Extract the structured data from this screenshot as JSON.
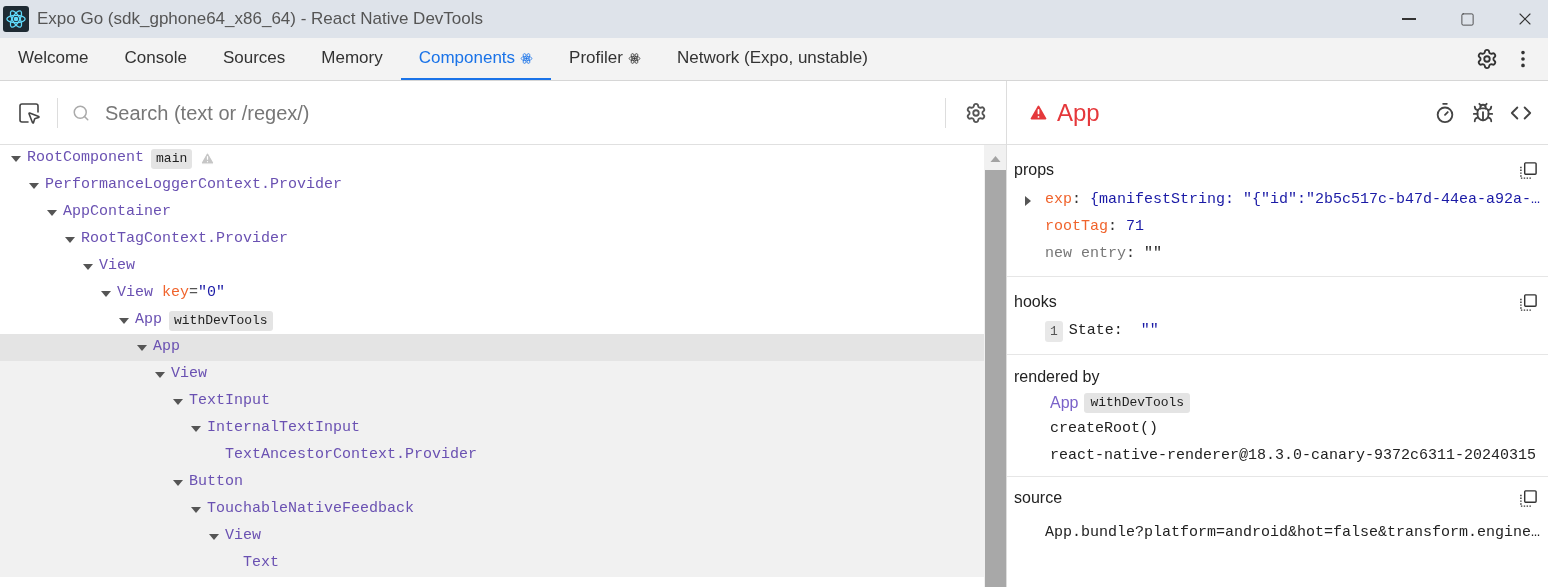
{
  "window": {
    "title": "Expo Go (sdk_gphone64_x86_64) - React Native DevTools"
  },
  "tabs": [
    {
      "label": "Welcome",
      "selected": false
    },
    {
      "label": "Console",
      "selected": false
    },
    {
      "label": "Sources",
      "selected": false
    },
    {
      "label": "Memory",
      "selected": false
    },
    {
      "label": "Components",
      "selected": true,
      "react_icon": true
    },
    {
      "label": "Profiler",
      "selected": false,
      "react_icon": true
    },
    {
      "label": "Network (Expo, unstable)",
      "selected": false
    }
  ],
  "search": {
    "placeholder": "Search (text or /regex/)"
  },
  "tree": [
    {
      "name": "RootComponent",
      "badge": "main",
      "warning": true,
      "expanded": true,
      "selected": false,
      "children": [
        {
          "name": "PerformanceLoggerContext.Provider",
          "expanded": true,
          "selected": false,
          "children": [
            {
              "name": "AppContainer",
              "expanded": true,
              "selected": false,
              "children": [
                {
                  "name": "RootTagContext.Provider",
                  "expanded": true,
                  "selected": false,
                  "children": [
                    {
                      "name": "View",
                      "expanded": true,
                      "selected": false,
                      "children": [
                        {
                          "name": "View",
                          "key_name": "key",
                          "key_sep": "=",
                          "key_value": "\"0\"",
                          "expanded": true,
                          "selected": false,
                          "children": [
                            {
                              "name": "App",
                              "badge": "withDevTools",
                              "expanded": true,
                              "selected": false,
                              "children": [
                                {
                                  "name": "App",
                                  "expanded": true,
                                  "selected": true,
                                  "children": [
                                    {
                                      "name": "View",
                                      "expanded": true,
                                      "selected": false,
                                      "children": [
                                        {
                                          "name": "TextInput",
                                          "expanded": true,
                                          "selected": false,
                                          "children": [
                                            {
                                              "name": "InternalTextInput",
                                              "expanded": true,
                                              "selected": false,
                                              "children": [
                                                {
                                                  "name": "TextAncestorContext.Provider",
                                                  "selected": false
                                                }
                                              ]
                                            }
                                          ]
                                        },
                                        {
                                          "name": "Button",
                                          "expanded": true,
                                          "selected": false,
                                          "children": [
                                            {
                                              "name": "TouchableNativeFeedback",
                                              "expanded": true,
                                              "selected": false,
                                              "children": [
                                                {
                                                  "name": "View",
                                                  "expanded": true,
                                                  "selected": false,
                                                  "children": [
                                                    {
                                                      "name": "Text",
                                                      "selected": false
                                                    }
                                                  ]
                                                }
                                              ]
                                            }
                                          ]
                                        }
                                      ]
                                    }
                                  ]
                                }
                              ]
                            }
                          ]
                        }
                      ]
                    }
                  ]
                }
              ]
            }
          ]
        }
      ]
    }
  ],
  "inspector": {
    "title": "App",
    "warning": true,
    "props": {
      "heading": "props",
      "entries": [
        {
          "name": "exp",
          "separator": ":",
          "value": "{manifestString: \"{\"id\":\"2b5c517c-b47d-44ea-a92a-…",
          "expanded": false,
          "kind": "object"
        },
        {
          "name": "rootTag",
          "separator": ":",
          "value": "71",
          "kind": "value"
        },
        {
          "name": "new entry",
          "separator": ":",
          "value": "\"\"",
          "kind": "new"
        }
      ]
    },
    "hooks": {
      "heading": "hooks",
      "entries": [
        {
          "index": "1",
          "name": "State",
          "separator": ":",
          "value": "\"\""
        }
      ]
    },
    "rendered_by": {
      "heading": "rendered by",
      "entries": [
        {
          "kind": "component",
          "name": "App",
          "badge": "withDevTools"
        },
        {
          "kind": "text",
          "name": "createRoot()"
        },
        {
          "kind": "text",
          "name": "react-native-renderer@18.3.0-canary-9372c6311-20240315"
        }
      ]
    },
    "source": {
      "heading": "source",
      "value": "App.bundle?platform=android&hot=false&transform.engine…"
    }
  }
}
